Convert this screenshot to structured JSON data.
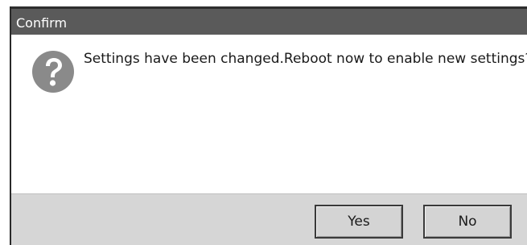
{
  "dialog": {
    "title": "Confirm",
    "message": "Settings have been changed.Reboot now to enable new settings?",
    "icon": "question-icon"
  },
  "buttons": {
    "yes_label": "Yes",
    "no_label": "No"
  },
  "colors": {
    "titlebar": "#5a5a5a",
    "button_bar": "#d6d6d6",
    "icon": "#8a8a8a"
  }
}
